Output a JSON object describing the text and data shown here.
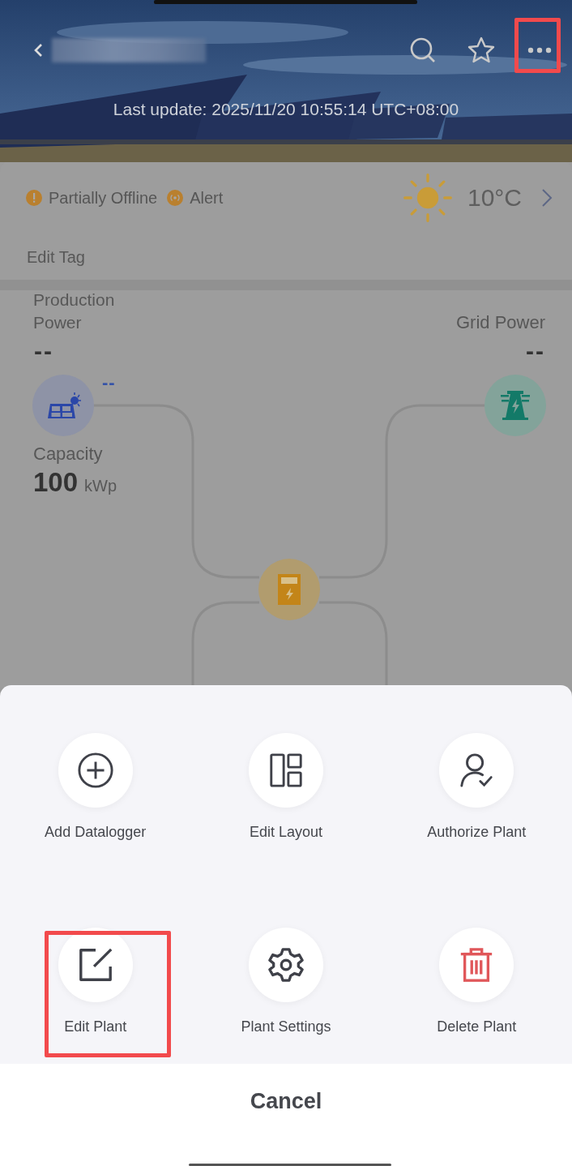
{
  "header": {
    "last_update": "Last update: 2025/11/20 10:55:14 UTC+08:00",
    "more_highlighted": true
  },
  "status": [
    {
      "kind": "warning",
      "label": "Partially Offline"
    },
    {
      "kind": "alert",
      "label": "Alert"
    }
  ],
  "weather": {
    "temperature": "10°C"
  },
  "edit_tag": "Edit Tag",
  "production_power": {
    "label": "Production Power",
    "value": "--",
    "pv_value": "--"
  },
  "capacity": {
    "label": "Capacity",
    "value": "100",
    "unit": "kWp"
  },
  "grid_power": {
    "label": "Grid Power",
    "value": "--"
  },
  "actions": [
    {
      "kind": "add",
      "label": "Add Datalogger",
      "highlighted": false
    },
    {
      "kind": "layout",
      "label": "Edit Layout",
      "highlighted": false
    },
    {
      "kind": "authorize",
      "label": "Authorize Plant",
      "highlighted": false
    },
    {
      "kind": "edit",
      "label": "Edit Plant",
      "highlighted": true
    },
    {
      "kind": "settings",
      "label": "Plant Settings",
      "highlighted": false
    },
    {
      "kind": "delete",
      "label": "Delete Plant",
      "highlighted": false
    }
  ],
  "cancel": "Cancel"
}
